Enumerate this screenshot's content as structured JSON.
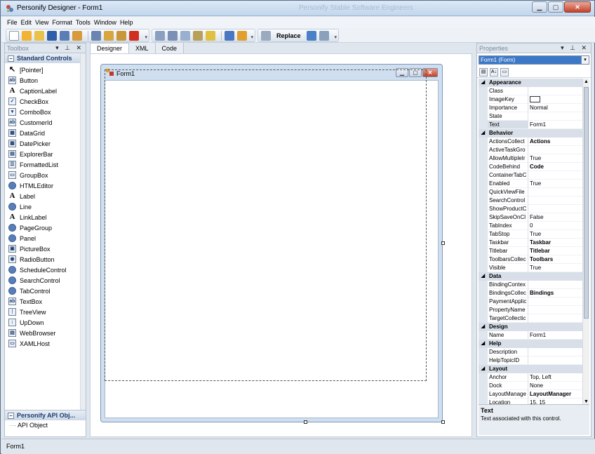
{
  "window": {
    "title": "Personify Designer - Form1",
    "ghost_title": "Personify Stable Software Engineers"
  },
  "menu": [
    "File",
    "Edit",
    "View",
    "Format",
    "Tools",
    "Window",
    "Help"
  ],
  "toolbar": {
    "replace_label": "Replace"
  },
  "toolbox": {
    "title": "Toolbox",
    "category": "Standard Controls",
    "items": [
      {
        "label": "[Pointer]",
        "icon": "pointer-icon",
        "glyph": "↖"
      },
      {
        "label": "Button",
        "icon": "button-icon",
        "glyph": "ab"
      },
      {
        "label": "CaptionLabel",
        "icon": "caption-label-icon",
        "glyph": "A"
      },
      {
        "label": "CheckBox",
        "icon": "checkbox-icon",
        "glyph": "✓"
      },
      {
        "label": "ComboBox",
        "icon": "combobox-icon",
        "glyph": "▾"
      },
      {
        "label": "CustomerId",
        "icon": "customer-id-icon",
        "glyph": "ab"
      },
      {
        "label": "DataGrid",
        "icon": "datagrid-icon",
        "glyph": "▦"
      },
      {
        "label": "DatePicker",
        "icon": "datepicker-icon",
        "glyph": "▦"
      },
      {
        "label": "ExplorerBar",
        "icon": "explorer-bar-icon",
        "glyph": "▤"
      },
      {
        "label": "FormattedList",
        "icon": "formatted-list-icon",
        "glyph": "☰"
      },
      {
        "label": "GroupBox",
        "icon": "groupbox-icon",
        "glyph": "▭"
      },
      {
        "label": "HTMLEditor",
        "icon": "html-editor-icon",
        "glyph": ""
      },
      {
        "label": "Label",
        "icon": "label-icon",
        "glyph": "A"
      },
      {
        "label": "Line",
        "icon": "line-icon",
        "glyph": ""
      },
      {
        "label": "LinkLabel",
        "icon": "link-label-icon",
        "glyph": "A"
      },
      {
        "label": "PageGroup",
        "icon": "page-group-icon",
        "glyph": ""
      },
      {
        "label": "Panel",
        "icon": "panel-icon",
        "glyph": ""
      },
      {
        "label": "PictureBox",
        "icon": "picturebox-icon",
        "glyph": "▣"
      },
      {
        "label": "RadioButton",
        "icon": "radiobutton-icon",
        "glyph": "◉"
      },
      {
        "label": "ScheduleControl",
        "icon": "schedule-control-icon",
        "glyph": ""
      },
      {
        "label": "SearchControl",
        "icon": "search-control-icon",
        "glyph": ""
      },
      {
        "label": "TabControl",
        "icon": "tab-control-icon",
        "glyph": ""
      },
      {
        "label": "TextBox",
        "icon": "textbox-icon",
        "glyph": "ab"
      },
      {
        "label": "TreeView",
        "icon": "treeview-icon",
        "glyph": "⋮"
      },
      {
        "label": "UpDown",
        "icon": "updown-icon",
        "glyph": "↕"
      },
      {
        "label": "WebBrowser",
        "icon": "webbrowser-icon",
        "glyph": "▤"
      },
      {
        "label": "XAMLHost",
        "icon": "xamlhost-icon",
        "glyph": "▭"
      }
    ],
    "api_category": "Personify API Obj...",
    "api_items": [
      "API Object"
    ]
  },
  "tabs": [
    "Designer",
    "XML",
    "Code"
  ],
  "form": {
    "title": "Form1"
  },
  "properties": {
    "title": "Properties",
    "object": "Form1 (Form)",
    "rows": [
      {
        "cat": "Appearance"
      },
      {
        "name": "Class",
        "value": ""
      },
      {
        "name": "ImageKey",
        "value": "",
        "swatch": true
      },
      {
        "name": "Importance",
        "value": "Normal"
      },
      {
        "name": "State",
        "value": ""
      },
      {
        "name": "Text",
        "value": "Form1",
        "selected": true
      },
      {
        "cat": "Behavior"
      },
      {
        "name": "ActionsCollect",
        "value": "Actions",
        "bold": true
      },
      {
        "name": "ActiveTaskGro",
        "value": ""
      },
      {
        "name": "AllowMultipleIr",
        "value": "True"
      },
      {
        "name": "CodeBehind",
        "value": "Code",
        "bold": true
      },
      {
        "name": "ContainerTabC",
        "value": ""
      },
      {
        "name": "Enabled",
        "value": "True"
      },
      {
        "name": "QuickViewFile",
        "value": ""
      },
      {
        "name": "SearchControl",
        "value": ""
      },
      {
        "name": "ShowProductC",
        "value": ""
      },
      {
        "name": "SkipSaveOnCl",
        "value": "False"
      },
      {
        "name": "TabIndex",
        "value": "0"
      },
      {
        "name": "TabStop",
        "value": "True"
      },
      {
        "name": "Taskbar",
        "value": "Taskbar",
        "bold": true
      },
      {
        "name": "Titlebar",
        "value": "Titlebar",
        "bold": true
      },
      {
        "name": "ToolbarsCollec",
        "value": "Toolbars",
        "bold": true
      },
      {
        "name": "Visible",
        "value": "True"
      },
      {
        "cat": "Data"
      },
      {
        "name": "BindingContex",
        "value": ""
      },
      {
        "name": "BindingsCollec",
        "value": "Bindings",
        "bold": true
      },
      {
        "name": "PaymentApplic",
        "value": ""
      },
      {
        "name": "PropertyName",
        "value": ""
      },
      {
        "name": "TargetCollectic",
        "value": ""
      },
      {
        "cat": "Design"
      },
      {
        "name": "Name",
        "value": "Form1"
      },
      {
        "cat": "Help"
      },
      {
        "name": "Description",
        "value": ""
      },
      {
        "name": "HelpTopicID",
        "value": ""
      },
      {
        "cat": "Layout"
      },
      {
        "name": "Anchor",
        "value": "Top, Left"
      },
      {
        "name": "Dock",
        "value": "None"
      },
      {
        "name": "LayoutManage",
        "value": "LayoutManager",
        "bold": true
      },
      {
        "name": "Location",
        "value": "15, 15"
      }
    ],
    "description_title": "Text",
    "description_text": "Text associated with this control."
  },
  "status": {
    "text": "Form1"
  }
}
